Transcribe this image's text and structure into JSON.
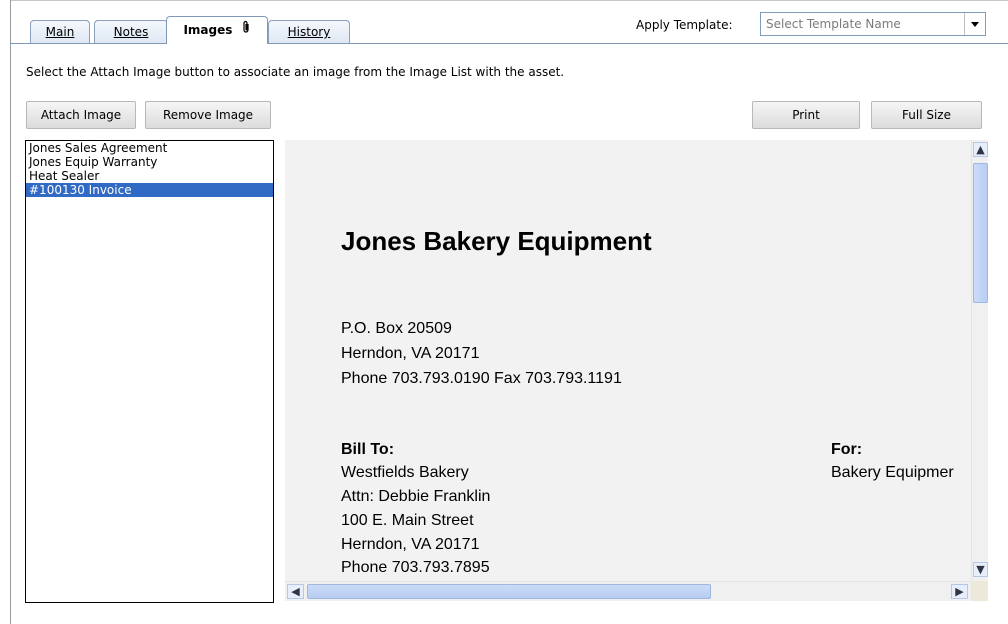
{
  "tabs": [
    {
      "label": "Main"
    },
    {
      "label": "Notes"
    },
    {
      "label": "Images"
    },
    {
      "label": "History"
    }
  ],
  "template": {
    "label": "Apply Template:",
    "placeholder": "Select Template Name"
  },
  "instructions": "Select the Attach Image button to associate an image from the Image List with the asset.",
  "buttons": {
    "attach": "Attach Image",
    "remove": "Remove Image",
    "print": "Print",
    "full_size": "Full Size"
  },
  "image_list": [
    "Jones Sales Agreement",
    "Jones Equip Warranty",
    "Heat Sealer",
    "#100130 Invoice"
  ],
  "selected_index": 3,
  "document": {
    "company": "Jones Bakery Equipment",
    "address": [
      "P.O. Box 20509",
      "Herndon, VA  20171",
      "Phone 703.793.0190   Fax 703.793.1191"
    ],
    "bill_to_heading": "Bill To:",
    "bill_to": [
      "Westfields Bakery",
      "Attn:  Debbie Franklin",
      "100 E. Main Street",
      "Herndon, VA  20171",
      "Phone 703.793.7895"
    ],
    "for_heading": "For:",
    "for_value": "Bakery Equipmer"
  },
  "icons": {
    "attachment": "paperclip-icon",
    "dropdown": "chevron-down-icon"
  }
}
